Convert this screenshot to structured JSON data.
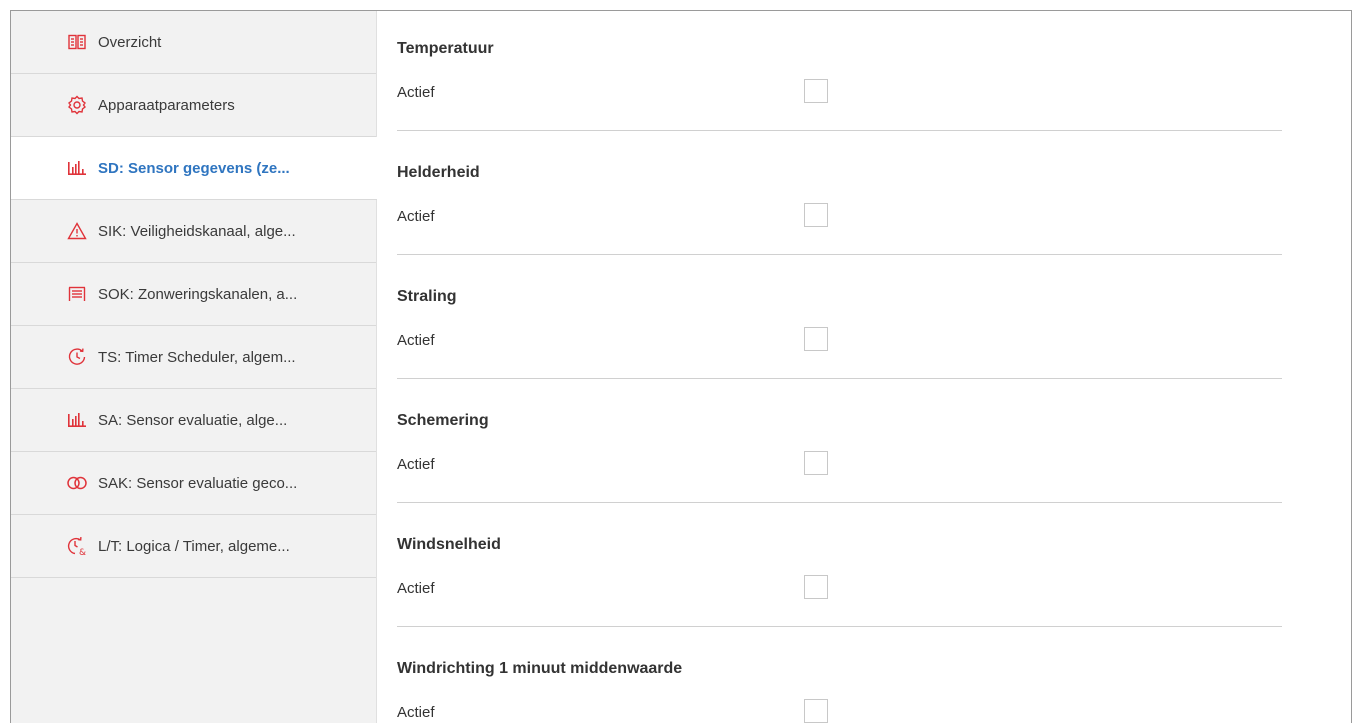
{
  "sidebar": {
    "items": [
      {
        "label": "Overzicht",
        "icon": "book-icon",
        "active": false
      },
      {
        "label": "Apparaatparameters",
        "icon": "gear-icon",
        "active": false
      },
      {
        "label": "SD: Sensor gegevens (ze...",
        "icon": "bar-chart-icon",
        "active": true
      },
      {
        "label": "SIK: Veiligheidskanaal, alge...",
        "icon": "warning-icon",
        "active": false
      },
      {
        "label": "SOK: Zonweringskanalen, a...",
        "icon": "blinds-icon",
        "active": false
      },
      {
        "label": "TS: Timer Scheduler, algem...",
        "icon": "timer-icon",
        "active": false
      },
      {
        "label": "SA: Sensor evaluatie, alge...",
        "icon": "bar-chart-icon",
        "active": false
      },
      {
        "label": "SAK: Sensor evaluatie geco...",
        "icon": "linked-rings-icon",
        "active": false
      },
      {
        "label": "L/T: Logica / Timer, algeme...",
        "icon": "logic-timer-icon",
        "active": false
      }
    ]
  },
  "main": {
    "sections": [
      {
        "title": "Temperatuur",
        "param_label": "Actief",
        "checked": false
      },
      {
        "title": "Helderheid",
        "param_label": "Actief",
        "checked": false
      },
      {
        "title": "Straling",
        "param_label": "Actief",
        "checked": false
      },
      {
        "title": "Schemering",
        "param_label": "Actief",
        "checked": false
      },
      {
        "title": "Windsnelheid",
        "param_label": "Actief",
        "checked": false
      },
      {
        "title": "Windrichting 1 minuut middenwaarde",
        "param_label": "Actief",
        "checked": false
      }
    ]
  },
  "colors": {
    "accent": "#2f75c0",
    "icon_red": "#e0333a",
    "sidebar_bg": "#f2f2f2"
  }
}
